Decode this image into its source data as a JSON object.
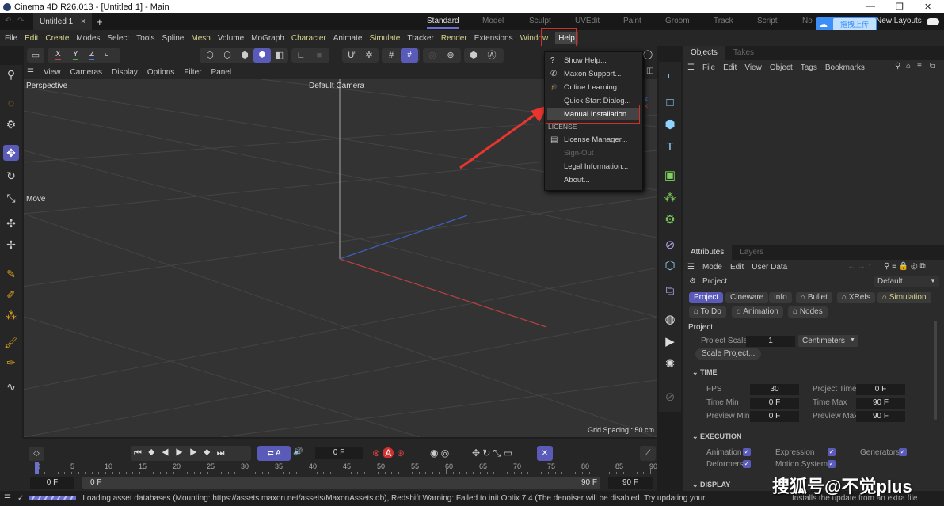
{
  "window": {
    "title": "Cinema 4D R26.013 - [Untitled 1] - Main"
  },
  "doc_tab": {
    "label": "Untitled 1",
    "close": "×",
    "add": "+"
  },
  "layouts": [
    "Standard",
    "Model",
    "Sculpt",
    "UVEdit",
    "Paint",
    "Groom",
    "Track",
    "Script",
    "No"
  ],
  "new_layouts": "New Layouts",
  "upload_badge": "拖拽上传",
  "menu": [
    "File",
    "Edit",
    "Create",
    "Modes",
    "Select",
    "Tools",
    "Spline",
    "Mesh",
    "Volume",
    "MoGraph",
    "Character",
    "Animate",
    "Simulate",
    "Tracker",
    "Render",
    "Extensions",
    "Window",
    "Help"
  ],
  "axes": {
    "x": "X",
    "y": "Y",
    "z": "Z"
  },
  "viewport": {
    "menu": [
      "View",
      "Cameras",
      "Display",
      "Options",
      "Filter",
      "Panel"
    ],
    "name": "Perspective",
    "camera": "Default Camera",
    "grid_spacing": "Grid Spacing : 50 cm",
    "tool_label": "Move"
  },
  "help_menu": {
    "items": [
      {
        "label": "Show Help...",
        "icon": "?"
      },
      {
        "label": "Maxon Support...",
        "icon": "✆"
      },
      {
        "label": "Online Learning...",
        "icon": "🎓"
      },
      {
        "label": "Quick Start Dialog...",
        "icon": ""
      },
      {
        "label": "Manual Installation...",
        "icon": ""
      }
    ],
    "section": "LICENSE",
    "license_items": [
      {
        "label": "License Manager...",
        "icon": "▤"
      },
      {
        "label": "Sign-Out",
        "icon": ""
      },
      {
        "label": "Legal Information...",
        "icon": ""
      },
      {
        "label": "About...",
        "icon": ""
      }
    ]
  },
  "objects_panel": {
    "tabs": [
      "Objects",
      "Takes"
    ],
    "menu": [
      "File",
      "Edit",
      "View",
      "Object",
      "Tags",
      "Bookmarks"
    ]
  },
  "attributes": {
    "tabs": [
      "Attributes",
      "Layers"
    ],
    "menu": [
      "Mode",
      "Edit",
      "User Data"
    ],
    "object": "Project",
    "preset": "Default",
    "chips": [
      "Project",
      "Cineware",
      "Info",
      "Bullet",
      "XRefs",
      "Simulation",
      "To Do",
      "Animation",
      "Nodes"
    ],
    "section_project": "Project",
    "project_scale_label": "Project Scale",
    "project_scale": "1",
    "unit": "Centimeters",
    "scale_button": "Scale Project...",
    "time": {
      "title": "TIME",
      "fps_label": "FPS",
      "fps": "30",
      "project_time_label": "Project Time",
      "project_time": "0 F",
      "time_min_label": "Time Min",
      "time_min": "0 F",
      "time_max_label": "Time Max",
      "time_max": "90 F",
      "preview_min_label": "Preview Min",
      "preview_min": "0 F",
      "preview_max_label": "Preview Max",
      "preview_max": "90 F"
    },
    "execution": {
      "title": "EXECUTION",
      "animation": "Animation",
      "expression": "Expression",
      "generators": "Generators",
      "deformers": "Deformers",
      "motion_system": "Motion System"
    },
    "display_title": "DISPLAY"
  },
  "timeline": {
    "current": "0 F",
    "ticks": [
      "0",
      "5",
      "10",
      "15",
      "20",
      "25",
      "30",
      "35",
      "40",
      "45",
      "50",
      "55",
      "60",
      "65",
      "70",
      "75",
      "80",
      "85",
      "90"
    ],
    "start": "0 F",
    "range_start": "0 F",
    "range_end": "90 F",
    "end": "90 F"
  },
  "status": {
    "message": "Loading asset databases (Mounting: https://assets.maxon.net/assets/MaxonAssets.db), Redshift Warning: Failed to init Optix 7.4 (The denoiser will be disabled. Try updating your NVidia drivers)",
    "right": "Installs the update from an extra file"
  },
  "watermark": "搜狐号@不觉plus",
  "colors": {
    "accent": "#5a5ab8",
    "highlight_box": "#d0302a",
    "arrow": "#e8352e"
  }
}
